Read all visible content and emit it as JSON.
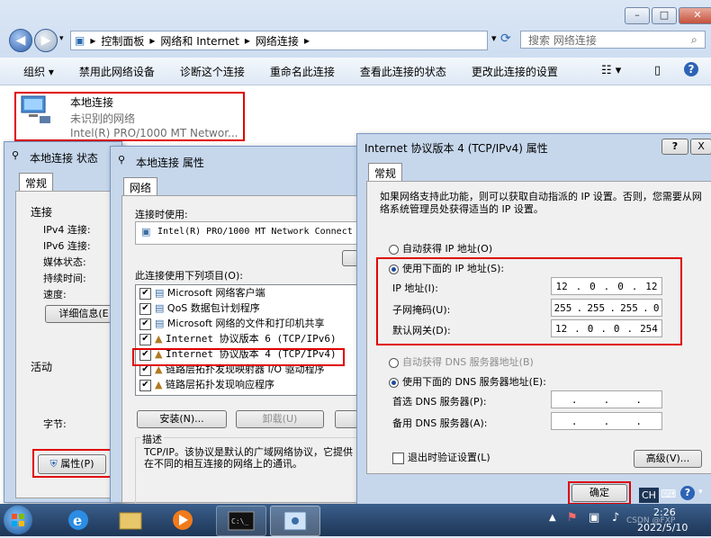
{
  "explorer": {
    "breadcrumbs": [
      "控制面板",
      "网络和 Internet",
      "网络连接"
    ],
    "search_placeholder": "搜索 网络连接",
    "toolbar": [
      "组织 ▾",
      "禁用此网络设备",
      "诊断这个连接",
      "重命名此连接",
      "查看此连接的状态",
      "更改此连接的设置"
    ],
    "connection": {
      "name": "本地连接",
      "status": "未识别的网络",
      "adapter": "Intel(R) PRO/1000 MT Networ..."
    }
  },
  "status_dialog": {
    "title": "本地连接 状态",
    "tab": "常规",
    "section_connection": "连接",
    "rows": [
      "IPv4 连接:",
      "IPv6 连接:",
      "媒体状态:",
      "持续时间:",
      "速度:"
    ],
    "details_button": "详细信息(E",
    "section_activity": "活动",
    "bytes_label": "字节:",
    "properties_button": "属性(P)"
  },
  "props_dialog": {
    "title": "本地连接 属性",
    "tab": "网络",
    "connect_using_label": "连接时使用:",
    "adapter": "Intel(R) PRO/1000 MT Network Connect",
    "items_label": "此连接使用下列项目(O):",
    "items": [
      {
        "label": "Microsoft 网络客户端",
        "checked": true
      },
      {
        "label": "QoS 数据包计划程序",
        "checked": true
      },
      {
        "label": "Microsoft 网络的文件和打印机共享",
        "checked": true
      },
      {
        "label": "Internet 协议版本 6 (TCP/IPv6)",
        "checked": true
      },
      {
        "label": "Internet 协议版本 4 (TCP/IPv4)",
        "checked": true
      },
      {
        "label": "链路层拓扑发现映射器 I/O 驱动程序",
        "checked": true
      },
      {
        "label": "链路层拓扑发现响应程序",
        "checked": true
      }
    ],
    "install_button": "安装(N)...",
    "uninstall_button": "卸载(U)",
    "description_label": "描述",
    "description": "TCP/IP。该协议是默认的广域网络协议，它提供在不同的相互连接的网络上的通讯。"
  },
  "ipv4_dialog": {
    "title": "Internet 协议版本 4 (TCP/IPv4) 属性",
    "tab": "常规",
    "intro": "如果网络支持此功能，则可以获取自动指派的 IP 设置。否则，您需要从网络系统管理员处获得适当的 IP 设置。",
    "auto_ip": "自动获得 IP 地址(O)",
    "manual_ip": "使用下面的 IP 地址(S):",
    "ip_label": "IP 地址(I):",
    "ip": [
      "12",
      "0",
      "0",
      "12"
    ],
    "mask_label": "子网掩码(U):",
    "mask": [
      "255",
      "255",
      "255",
      "0"
    ],
    "gateway_label": "默认网关(D):",
    "gateway": [
      "12",
      "0",
      "0",
      "254"
    ],
    "auto_dns": "自动获得 DNS 服务器地址(B)",
    "manual_dns": "使用下面的 DNS 服务器地址(E):",
    "dns1_label": "首选 DNS 服务器(P):",
    "dns2_label": "备用 DNS 服务器(A):",
    "validate_label": "退出时验证设置(L)",
    "advanced_button": "高级(V)...",
    "ok_button": "确定",
    "help_button": "?",
    "close_button": "X"
  },
  "taskbar": {
    "lang": "CH",
    "time": "2:26",
    "date": "2022/5/10",
    "watermark": "CSDN @FXP"
  },
  "colors": {
    "highlight": "#e00000",
    "titlebar": "#c6d7ec",
    "taskbar": "#1d3555"
  }
}
